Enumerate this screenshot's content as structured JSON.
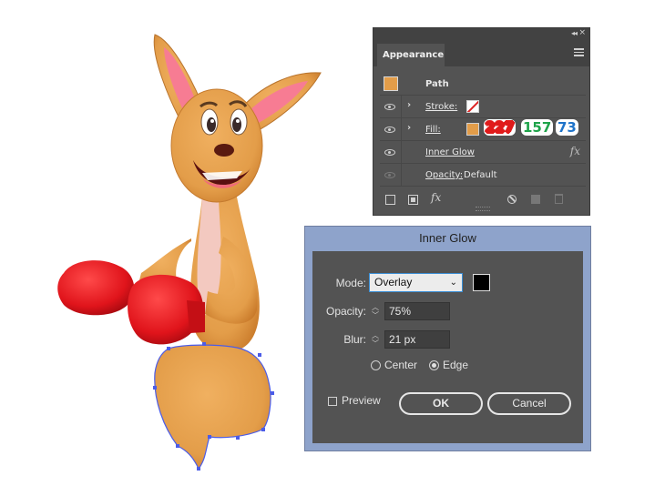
{
  "appearance_panel": {
    "collapse_glyph": "◂◂",
    "close_glyph": "×",
    "tab_label": "Appearance",
    "rows": {
      "path": {
        "label": "Path"
      },
      "stroke": {
        "label": "Stroke:"
      },
      "fill": {
        "label": "Fill:",
        "swatch_color": "#E39D49"
      },
      "inner_glow": {
        "label": "Inner Glow"
      },
      "opacity": {
        "label": "Opacity:",
        "value": "Default"
      }
    },
    "fx_glyph": "fx",
    "fill_rgb_annotation": {
      "r": "227",
      "g": "157",
      "b": "73"
    }
  },
  "inner_glow_dialog": {
    "title": "Inner Glow",
    "mode": {
      "label": "Mode:",
      "value": "Overlay",
      "color": "#000000"
    },
    "opacity": {
      "label": "Opacity:",
      "value": "75%"
    },
    "blur": {
      "label": "Blur:",
      "value": "21 px"
    },
    "source": {
      "center_label": "Center",
      "edge_label": "Edge",
      "selected": "Edge"
    },
    "preview": {
      "label": "Preview",
      "checked": false
    },
    "ok_label": "OK",
    "cancel_label": "Cancel"
  },
  "artwork": {
    "subject": "kangaroo-illustration",
    "colors": {
      "body": "#E39D49",
      "gloves": "#D9141B",
      "belly": "#F3C9C0",
      "selection": "#4B5CE8"
    }
  }
}
